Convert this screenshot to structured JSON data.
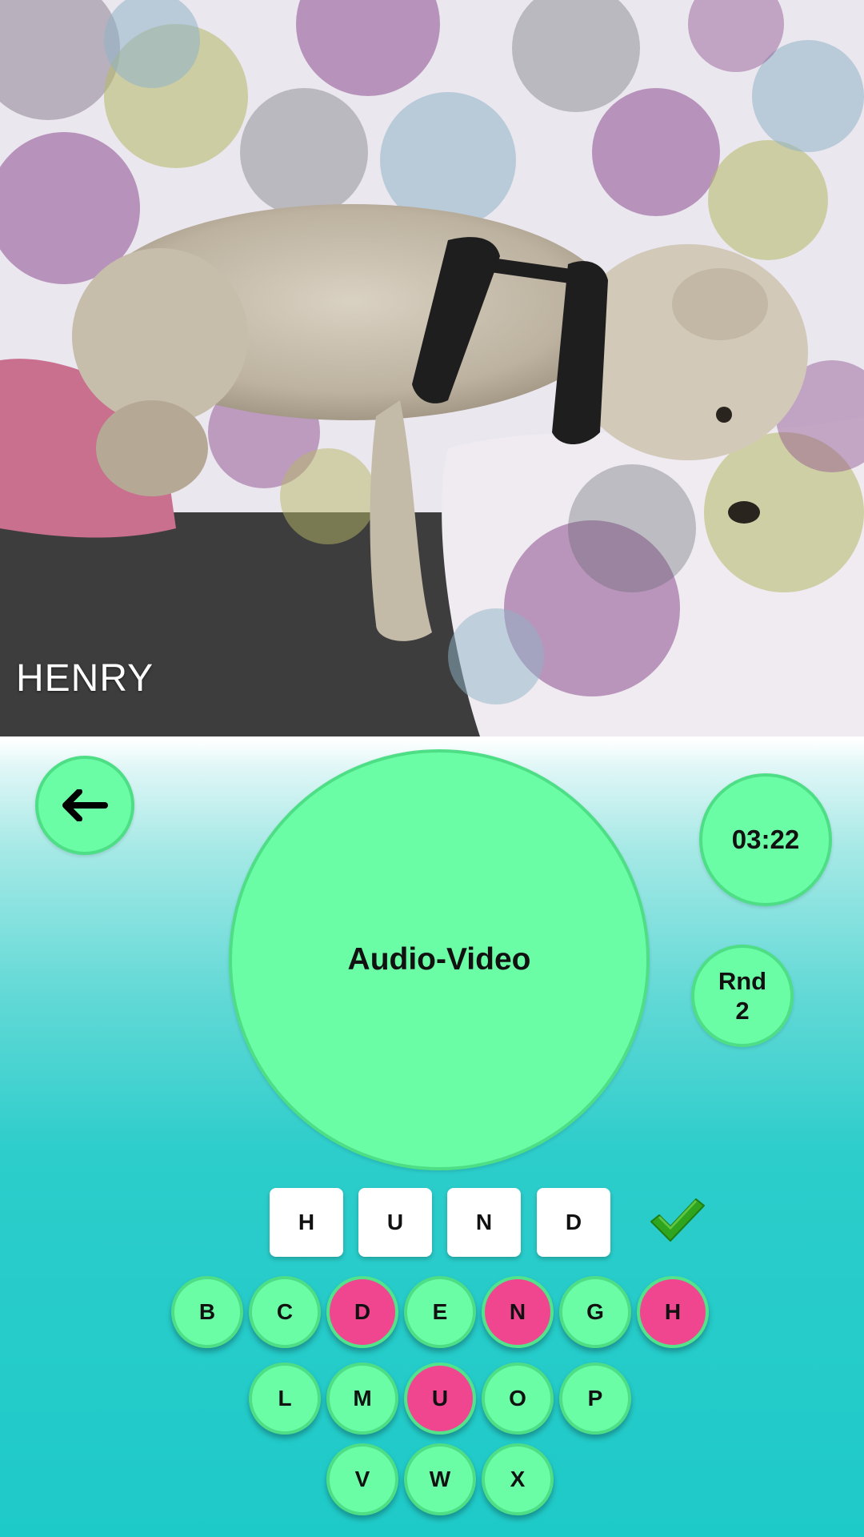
{
  "photo": {
    "caption": "HENRY"
  },
  "controls": {
    "back_icon": "arrow-left-icon",
    "timer": "03:22",
    "round_label": "Rnd",
    "round_number": "2",
    "category": "Audio-Video",
    "submit_icon": "checkmark-icon",
    "accent_green": "#6bfda5",
    "highlight_pink": "#f0468f"
  },
  "answer": {
    "tiles": [
      "H",
      "U",
      "N",
      "D"
    ]
  },
  "keyboard": {
    "row1": [
      {
        "letter": "B",
        "used": false
      },
      {
        "letter": "C",
        "used": false
      },
      {
        "letter": "D",
        "used": true
      },
      {
        "letter": "E",
        "used": false
      },
      {
        "letter": "N",
        "used": true
      },
      {
        "letter": "G",
        "used": false
      },
      {
        "letter": "H",
        "used": true
      }
    ],
    "row2": [
      {
        "letter": "L",
        "used": false
      },
      {
        "letter": "M",
        "used": false
      },
      {
        "letter": "U",
        "used": true
      },
      {
        "letter": "O",
        "used": false
      },
      {
        "letter": "P",
        "used": false
      }
    ],
    "row3": [
      {
        "letter": "V",
        "used": false
      },
      {
        "letter": "W",
        "used": false
      },
      {
        "letter": "X",
        "used": false
      }
    ]
  }
}
